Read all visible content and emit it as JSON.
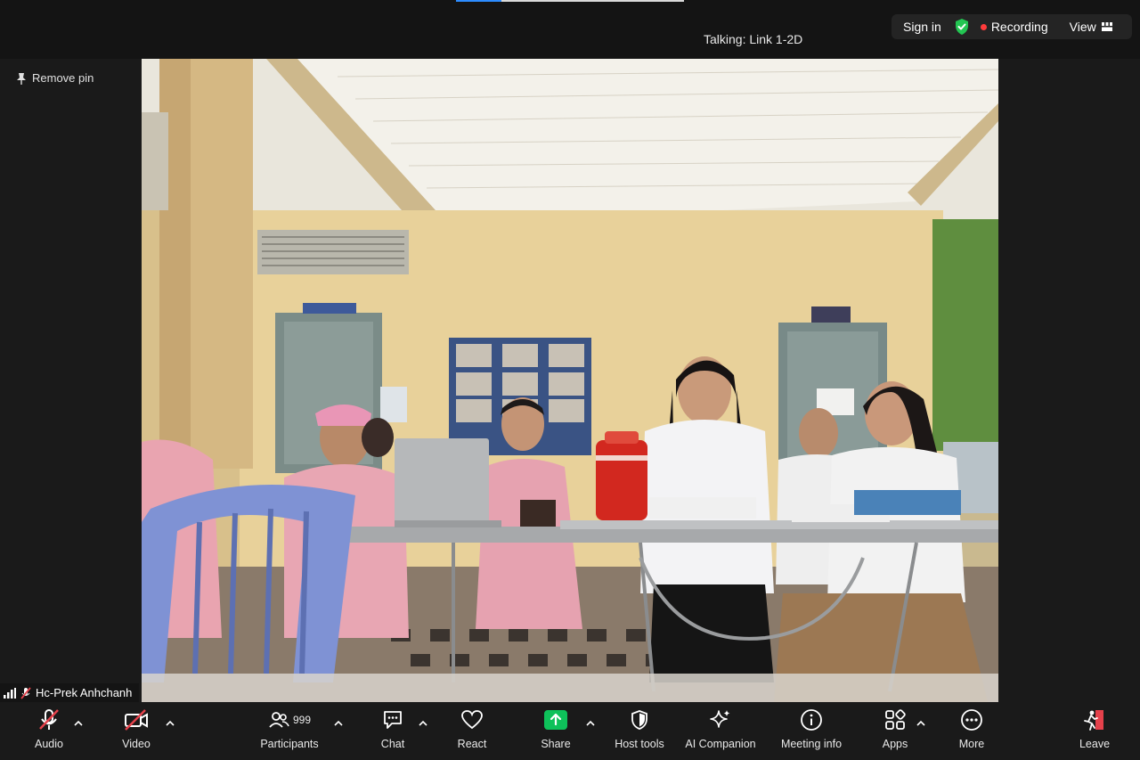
{
  "top": {
    "talking": "Talking: Link 1-2D",
    "sign_in": "Sign in",
    "recording": "Recording",
    "view": "View",
    "progress": 0.2
  },
  "side": {
    "remove_pin": "Remove pin"
  },
  "participant": {
    "name": "Hc-Prek Anhchanh"
  },
  "toolbar": {
    "audio": "Audio",
    "video": "Video",
    "participants": "Participants",
    "participants_count": "999",
    "chat": "Chat",
    "react": "React",
    "share": "Share",
    "host_tools": "Host tools",
    "ai_companion": "AI Companion",
    "meeting_info": "Meeting info",
    "apps": "Apps",
    "more": "More",
    "leave": "Leave"
  },
  "colors": {
    "share_green": "#0ec15a",
    "shield_green": "#23c552",
    "recording_red": "#ff3b3b",
    "muted_red": "#e5414b",
    "leave_red": "#e5414b"
  }
}
